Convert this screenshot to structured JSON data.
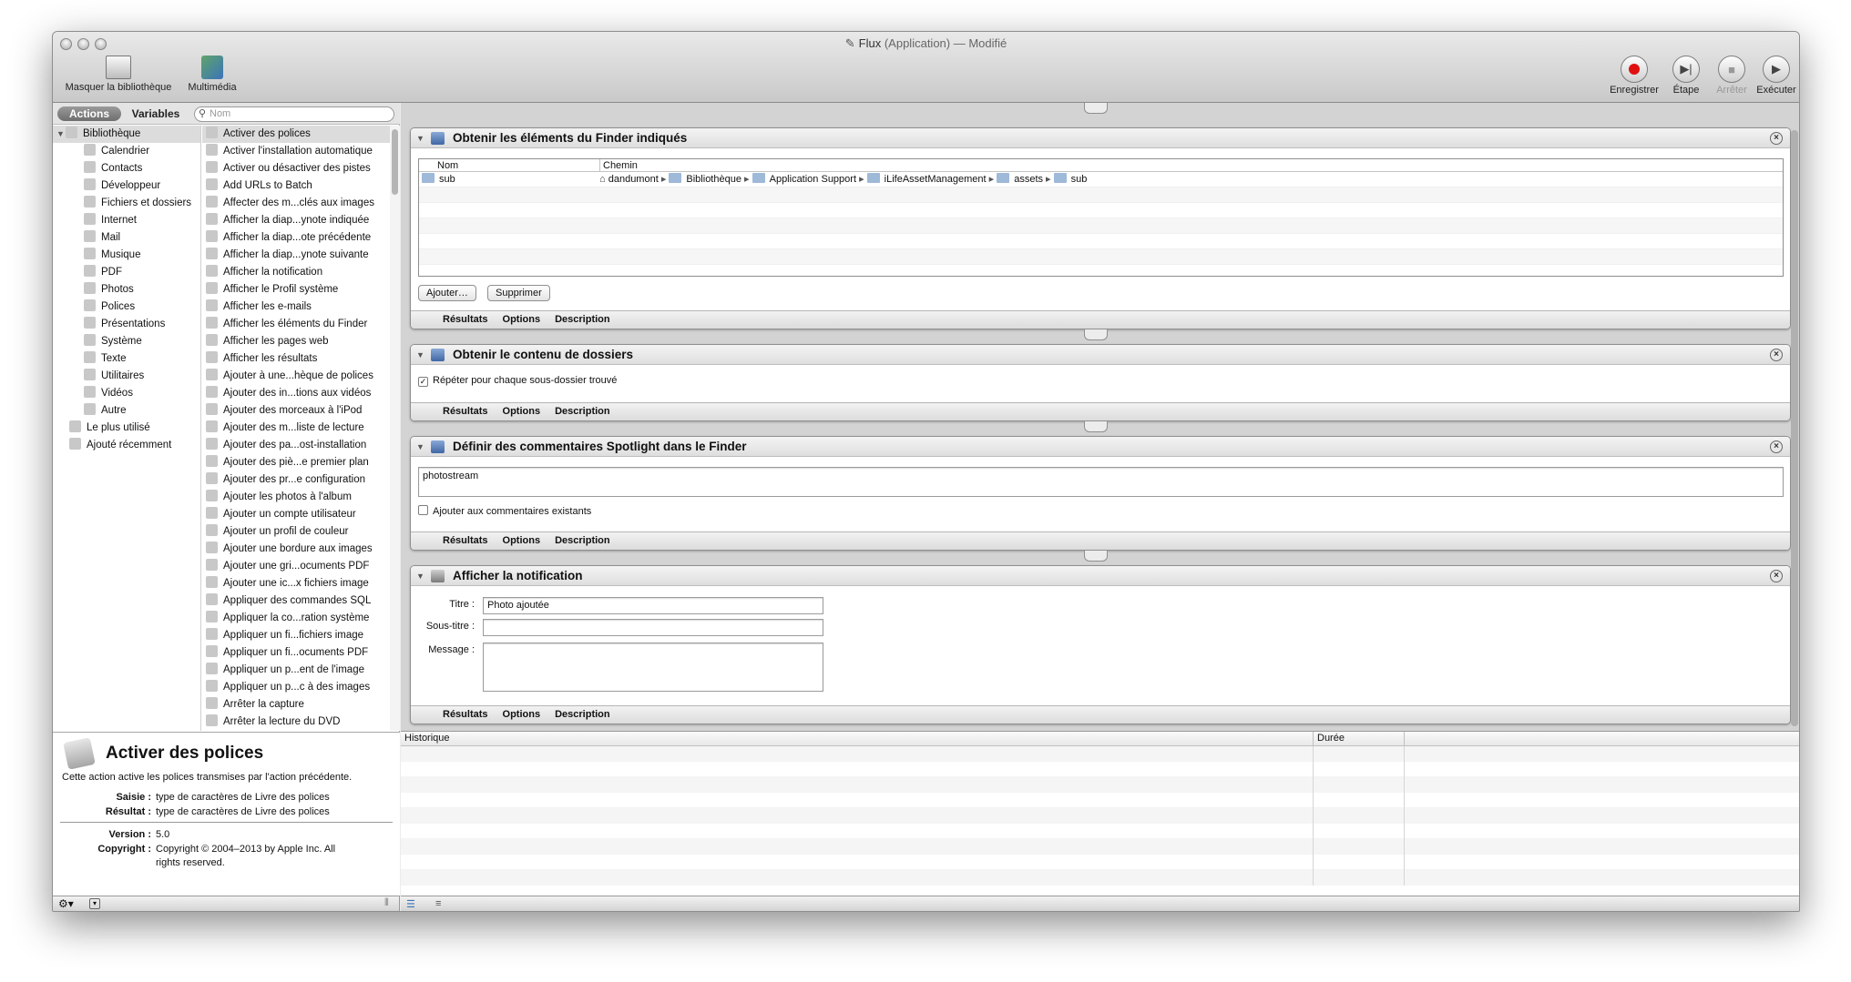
{
  "window": {
    "title_name": "Flux",
    "title_rest": " (Application) — Modifié"
  },
  "toolbar": {
    "hide_library": "Masquer la bibliothèque",
    "media": "Multimédia",
    "record": "Enregistrer",
    "step": "Étape",
    "stop": "Arrêter",
    "run": "Exécuter"
  },
  "library": {
    "tab_actions": "Actions",
    "tab_variables": "Variables",
    "search_placeholder": "Nom",
    "root": "Bibliothèque",
    "categories": [
      "Calendrier",
      "Contacts",
      "Développeur",
      "Fichiers et dossiers",
      "Internet",
      "Mail",
      "Musique",
      "PDF",
      "Photos",
      "Polices",
      "Présentations",
      "Système",
      "Texte",
      "Utilitaires",
      "Vidéos",
      "Autre"
    ],
    "smart": [
      "Le plus utilisé",
      "Ajouté récemment"
    ]
  },
  "actions_list": [
    "Activer des polices",
    "Activer l'installation automatique",
    "Activer ou désactiver des pistes",
    "Add URLs to Batch",
    "Affecter des m...clés aux images",
    "Afficher la diap...ynote indiquée",
    "Afficher la diap...ote précédente",
    "Afficher la diap...ynote suivante",
    "Afficher la notification",
    "Afficher le Profil système",
    "Afficher les e-mails",
    "Afficher les éléments du Finder",
    "Afficher les pages web",
    "Afficher les résultats",
    "Ajouter à une...hèque de polices",
    "Ajouter des in...tions aux vidéos",
    "Ajouter des morceaux à l'iPod",
    "Ajouter des m...liste de lecture",
    "Ajouter des pa...ost-installation",
    "Ajouter des piè...e premier plan",
    "Ajouter des pr...e configuration",
    "Ajouter les photos à l'album",
    "Ajouter un compte utilisateur",
    "Ajouter un profil de couleur",
    "Ajouter une bordure aux images",
    "Ajouter une gri...ocuments PDF",
    "Ajouter une ic...x fichiers image",
    "Appliquer des commandes SQL",
    "Appliquer la co...ration système",
    "Appliquer un fi...fichiers image",
    "Appliquer un fi...ocuments PDF",
    "Appliquer un p...ent de l'image",
    "Appliquer un p...c à des images",
    "Arrêter la capture",
    "Arrêter la lecture du DVD"
  ],
  "info": {
    "title": "Activer des polices",
    "description": "Cette action active les polices transmises par l'action précédente.",
    "input_label": "Saisie :",
    "input_value": "type de caractères de Livre des polices",
    "result_label": "Résultat :",
    "result_value": "type de caractères de Livre des polices",
    "version_label": "Version :",
    "version_value": "5.0",
    "copyright_label": "Copyright :",
    "copyright_line1": "Copyright © 2004–2013 by Apple Inc. All",
    "copyright_line2": "rights reserved."
  },
  "footer_tabs": {
    "results": "Résultats",
    "options": "Options",
    "description": "Description"
  },
  "step1": {
    "title": "Obtenir les éléments du Finder indiqués",
    "col_name": "Nom",
    "col_path": "Chemin",
    "item_name": "sub",
    "path": [
      "dandumont",
      "Bibliothèque",
      "Application Support",
      "iLifeAssetManagement",
      "assets",
      "sub"
    ],
    "add_btn": "Ajouter…",
    "remove_btn": "Supprimer"
  },
  "step2": {
    "title": "Obtenir le contenu de dossiers",
    "checkbox": "Répéter pour chaque sous-dossier trouvé"
  },
  "step3": {
    "title": "Définir des commentaires Spotlight dans le Finder",
    "comment": "photostream",
    "checkbox": "Ajouter aux commentaires existants"
  },
  "step4": {
    "title": "Afficher la notification",
    "title_label": "Titre :",
    "title_value": "Photo ajoutée",
    "subtitle_label": "Sous-titre :",
    "message_label": "Message :"
  },
  "history": {
    "col_history": "Historique",
    "col_duration": "Durée"
  }
}
